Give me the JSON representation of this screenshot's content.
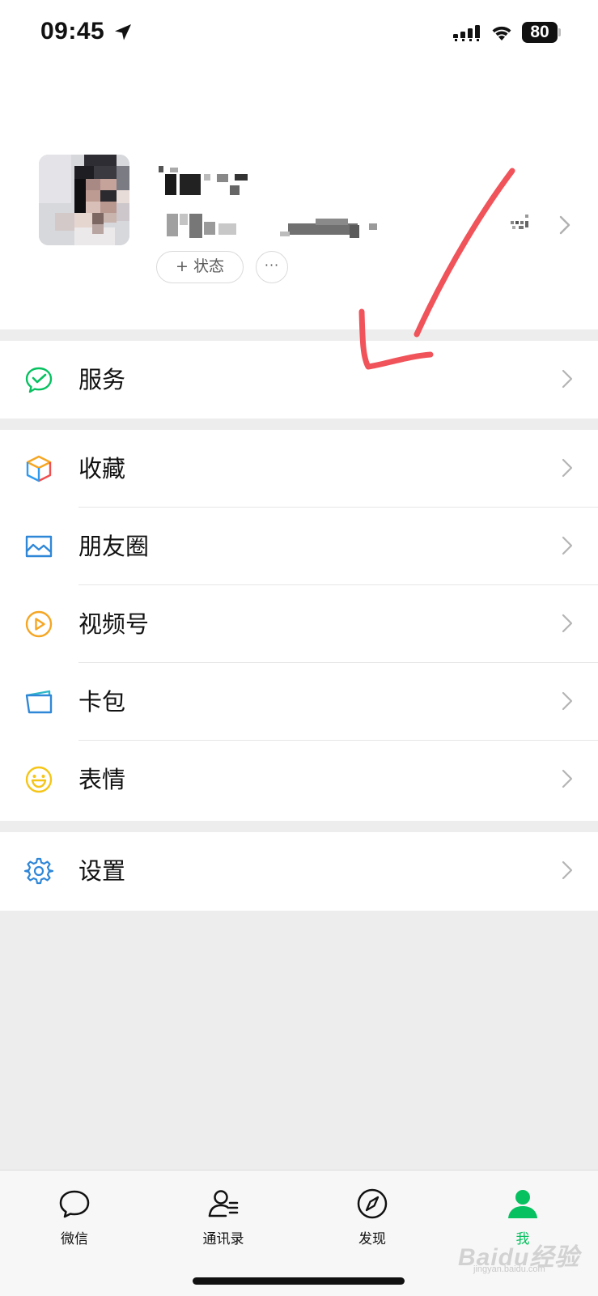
{
  "status_bar": {
    "time": "09:45",
    "battery": "80"
  },
  "profile": {
    "status_button": "+ 状态",
    "more_button": "···"
  },
  "menu": {
    "services": {
      "label": "服务",
      "icon": "wechat-pay-icon"
    },
    "favorites": {
      "label": "收藏",
      "icon": "cube-icon"
    },
    "moments": {
      "label": "朋友圈",
      "icon": "image-icon"
    },
    "channels": {
      "label": "视频号",
      "icon": "play-circle-icon"
    },
    "cards": {
      "label": "卡包",
      "icon": "wallet-icon"
    },
    "stickers": {
      "label": "表情",
      "icon": "smile-icon"
    },
    "settings": {
      "label": "设置",
      "icon": "gear-icon"
    }
  },
  "tabbar": {
    "chats": "微信",
    "contacts": "通讯录",
    "discover": "发现",
    "me": "我"
  },
  "watermark": {
    "text": "Baidu经验",
    "sub": "jingyan.baidu.com"
  },
  "colors": {
    "accent": "#07c160",
    "annotation": "#f0535a",
    "background": "#ededed"
  }
}
